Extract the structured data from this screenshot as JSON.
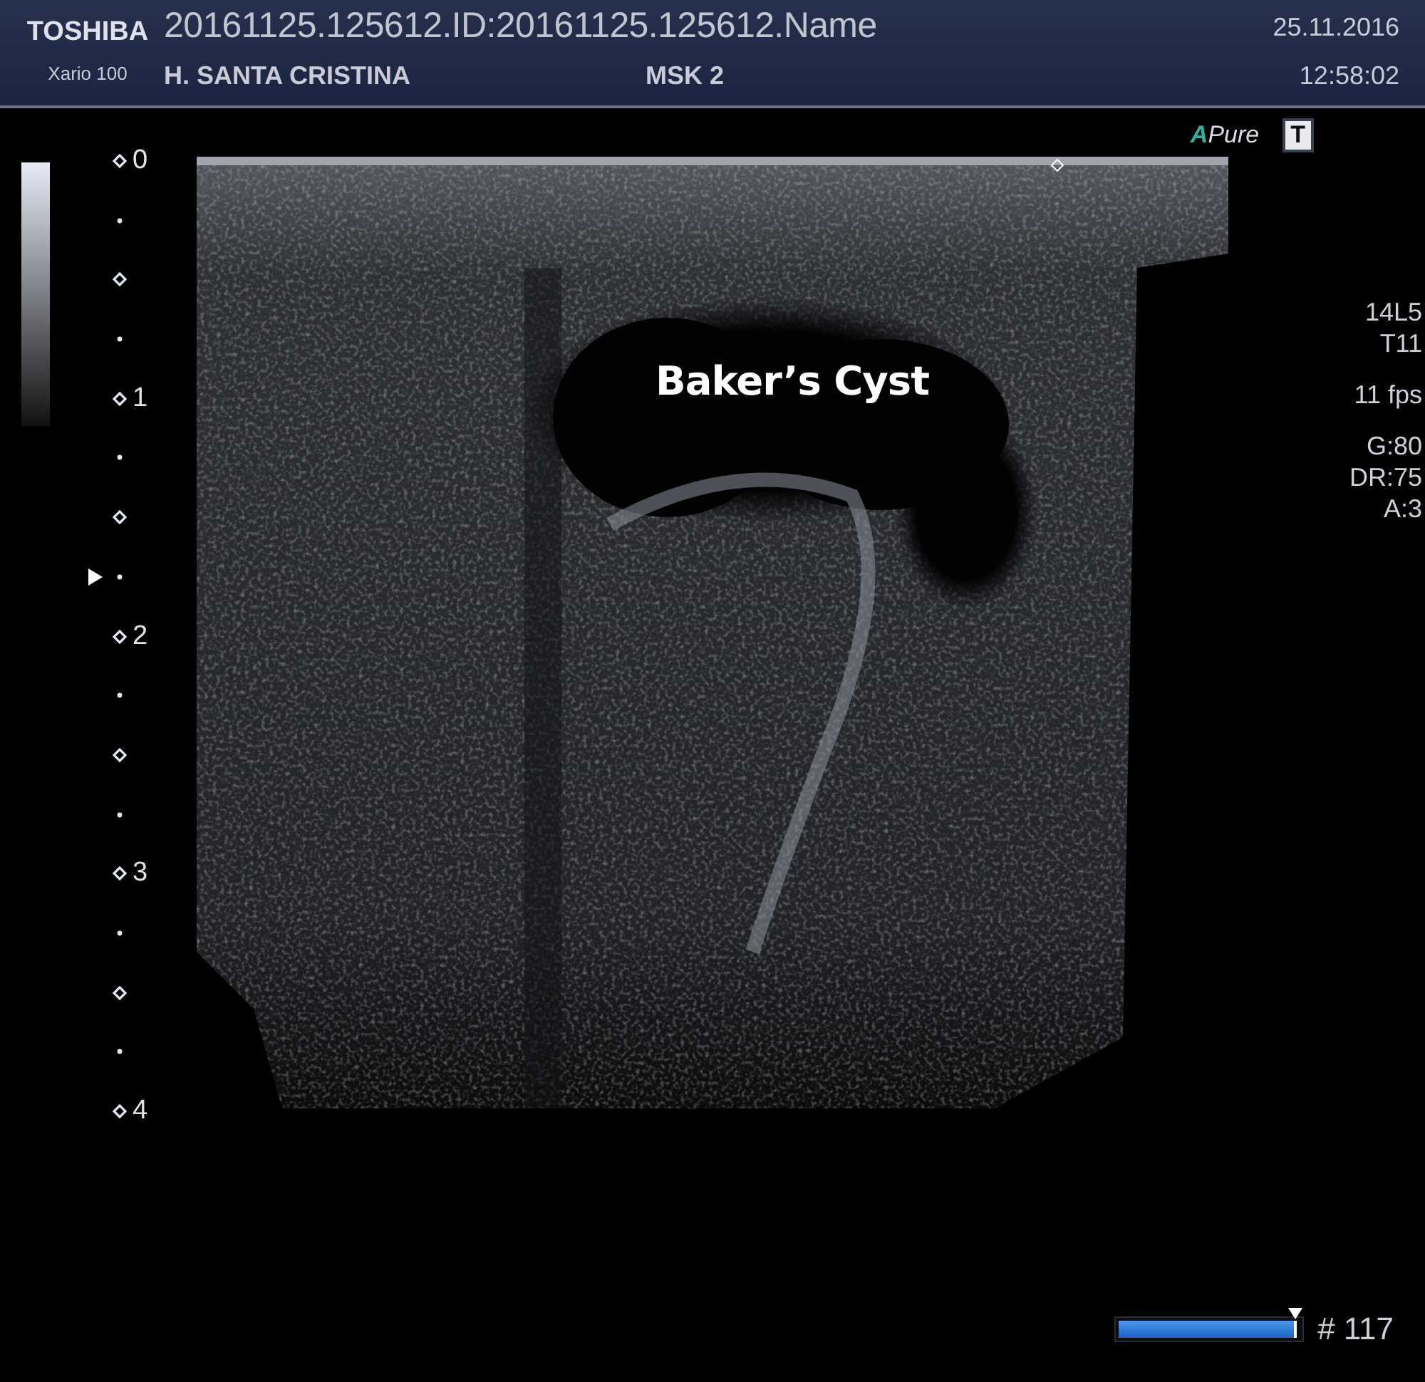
{
  "header": {
    "brand": "TOSHIBA",
    "model": "Xario 100",
    "patient_id": "20161125.125612.ID:20161125.125612.Name",
    "hospital": "H. SANTA CRISTINA",
    "preset": "MSK 2",
    "date": "25.11.2016",
    "time": "12:58:02"
  },
  "mode_indicator": {
    "logo_mark": "A",
    "logo_text": "Pure",
    "badge": "T"
  },
  "depth_scale": {
    "ticks": [
      {
        "kind": "labeled",
        "label": "0"
      },
      {
        "kind": "dot"
      },
      {
        "kind": "diamond"
      },
      {
        "kind": "dot"
      },
      {
        "kind": "labeled",
        "label": "1"
      },
      {
        "kind": "dot"
      },
      {
        "kind": "diamond"
      },
      {
        "kind": "focus"
      },
      {
        "kind": "labeled",
        "label": "2"
      },
      {
        "kind": "dot"
      },
      {
        "kind": "diamond"
      },
      {
        "kind": "dot"
      },
      {
        "kind": "labeled",
        "label": "3"
      },
      {
        "kind": "dot"
      },
      {
        "kind": "diamond"
      },
      {
        "kind": "dot"
      },
      {
        "kind": "labeled",
        "label": "4"
      }
    ]
  },
  "image": {
    "annotation": "Baker’s Cyst"
  },
  "parameters": [
    [
      "14L5",
      "T11"
    ],
    [
      "11 fps"
    ],
    [
      "G:80",
      "DR:75",
      "A:3"
    ]
  ],
  "cine": {
    "level": 1,
    "frame": "# 117"
  }
}
